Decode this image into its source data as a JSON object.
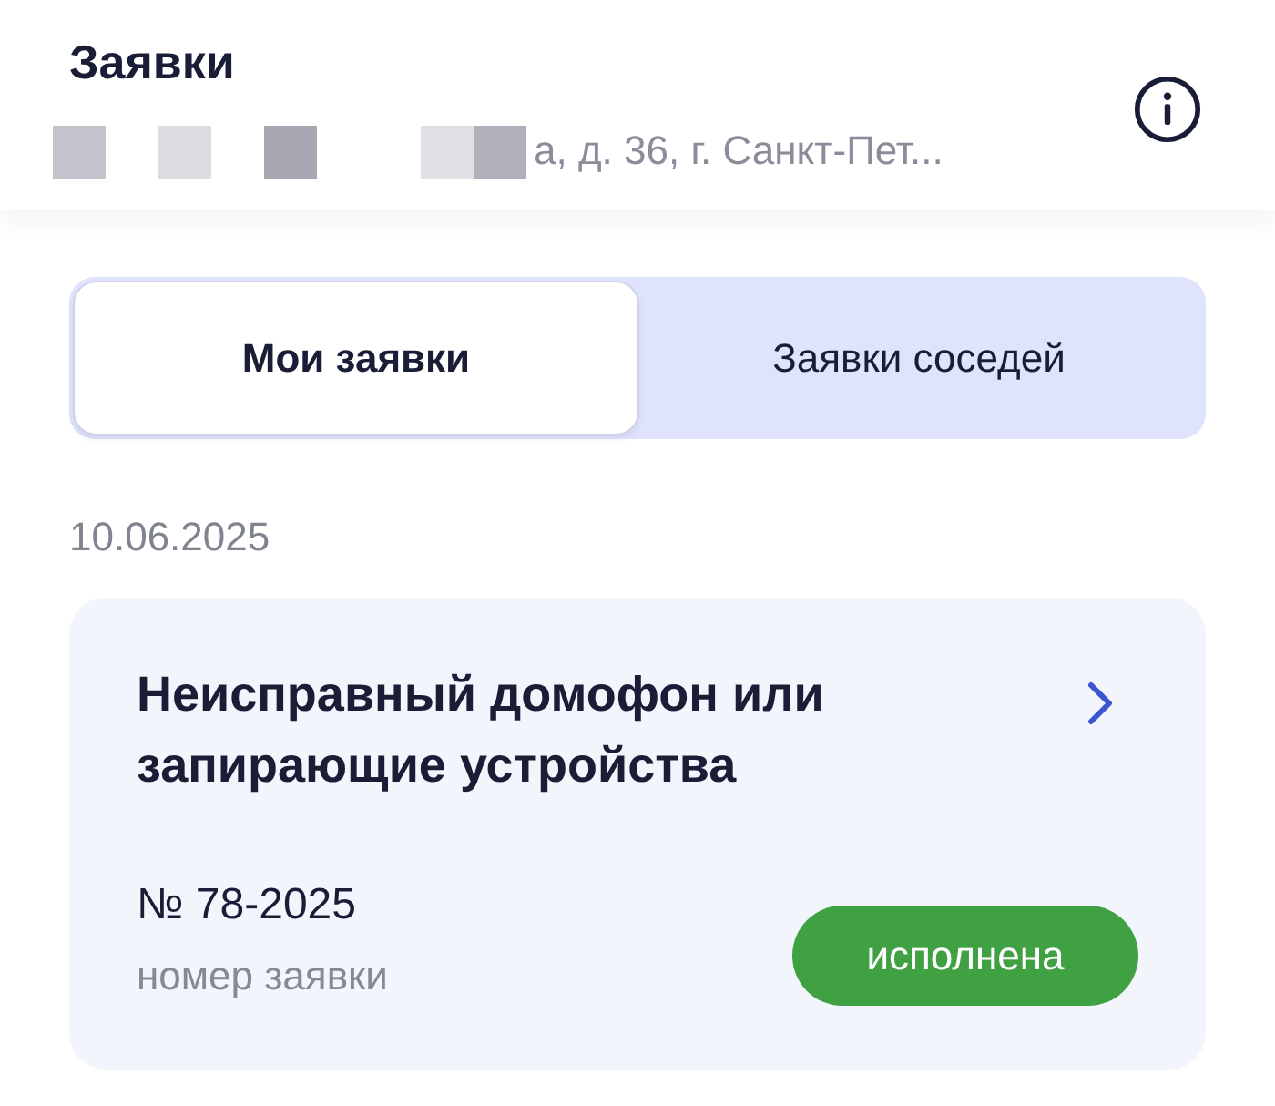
{
  "header": {
    "title": "Заявки",
    "address": "а, д. 36, г. Санкт-Пет..."
  },
  "tabs": [
    {
      "label": "Мои заявки",
      "selected": true
    },
    {
      "label": "Заявки соседей",
      "selected": false
    }
  ],
  "date_groups": [
    {
      "date": "10.06.2025",
      "requests": [
        {
          "title": "Неисправный домофон или запирающие устройства",
          "number": "№ 78-2025",
          "number_label": "номер заявки",
          "status": {
            "label": "исполнена",
            "kind": "done"
          }
        }
      ]
    }
  ]
}
